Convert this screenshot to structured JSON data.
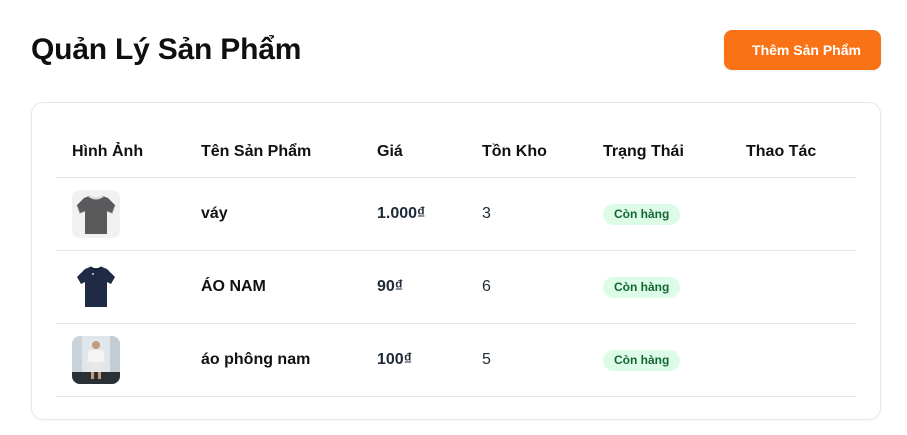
{
  "header": {
    "title": "Quản Lý Sản Phẩm",
    "add_button_label": "Thêm Sản Phẩm"
  },
  "colors": {
    "accent": "#f97316",
    "badge_bg": "#dcfce7",
    "badge_text": "#166534"
  },
  "table": {
    "columns": [
      "Hình Ảnh",
      "Tên Sản Phẩm",
      "Giá",
      "Tồn Kho",
      "Trạng Thái",
      "Thao Tác"
    ],
    "rows": [
      {
        "image_icon": "gray-tshirt-image",
        "name": "váy",
        "price": "1.000₫",
        "stock": "3",
        "status": "Còn hàng"
      },
      {
        "image_icon": "navy-tshirt-image",
        "name": "ÁO NAM",
        "price": "90₫",
        "stock": "6",
        "status": "Còn hàng"
      },
      {
        "image_icon": "fashion-photo-image",
        "name": "áo phông nam",
        "price": "100₫",
        "stock": "5",
        "status": "Còn hàng"
      }
    ]
  }
}
